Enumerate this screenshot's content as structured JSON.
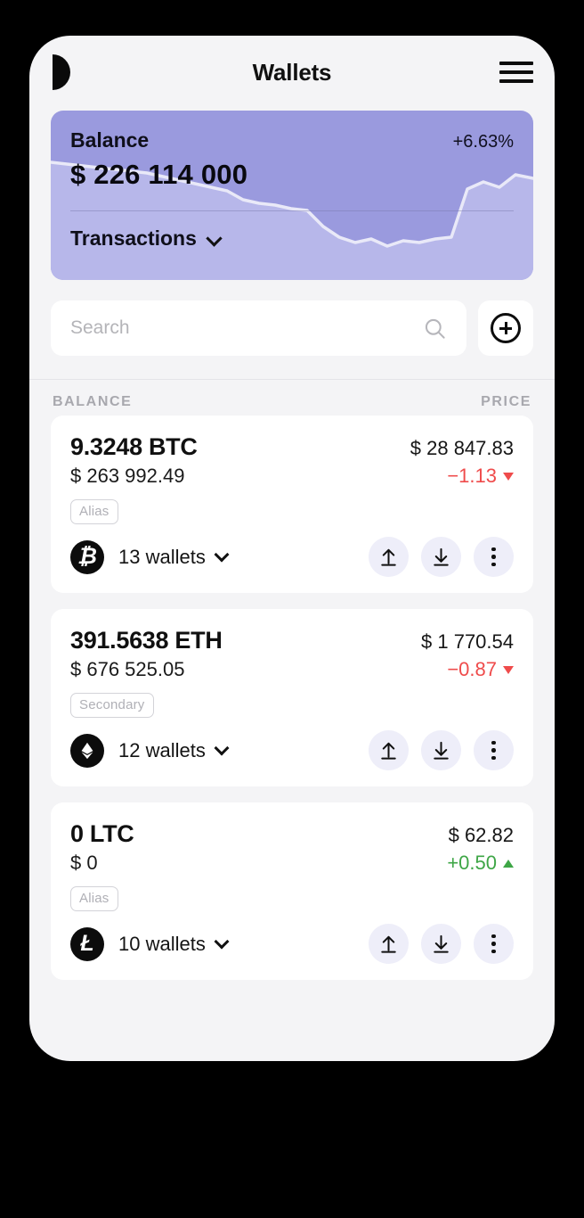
{
  "header": {
    "logo_icon": "brand-d-logo",
    "title": "Wallets",
    "menu_icon": "hamburger-menu-icon"
  },
  "balance_card": {
    "label": "Balance",
    "change": "+6.63%",
    "amount": "$ 226 114 000",
    "transactions_label": "Transactions",
    "chevron_icon": "chevron-down-icon",
    "bg_color": "#9a9ade",
    "area_color": "#b7b7ea",
    "line_color": "#e9e9f8"
  },
  "search": {
    "placeholder": "Search",
    "value": "",
    "icon": "search-icon",
    "add_icon": "plus-circle-icon"
  },
  "list_header": {
    "balance_col": "BALANCE",
    "price_col": "PRICE"
  },
  "assets": [
    {
      "amount": "9.3248 BTC",
      "fiat": "$ 263 992.49",
      "price": "$ 28 847.83",
      "delta": "−1.13",
      "delta_dir": "down",
      "tag": "Alias",
      "coin_icon": "bitcoin-icon",
      "coin_glyph": "₿",
      "wallets": "13 wallets"
    },
    {
      "amount": "391.5638 ETH",
      "fiat": "$ 676 525.05",
      "price": "$ 1 770.54",
      "delta": "−0.87",
      "delta_dir": "down",
      "tag": "Secondary",
      "coin_icon": "ethereum-icon",
      "coin_glyph": "",
      "wallets": "12 wallets"
    },
    {
      "amount": "0 LTC",
      "fiat": "$ 0",
      "price": "$ 62.82",
      "delta": "+0.50",
      "delta_dir": "up",
      "tag": "Alias",
      "coin_icon": "litecoin-icon",
      "coin_glyph": "Ł",
      "wallets": "10 wallets"
    }
  ],
  "actions": {
    "send_icon": "arrow-up-send-icon",
    "receive_icon": "arrow-down-receive-icon",
    "more_icon": "more-vertical-icon"
  },
  "chart_data": {
    "type": "area",
    "title": "Balance sparkline",
    "x": [
      0,
      1,
      2,
      3,
      4,
      5,
      6,
      7,
      8,
      9,
      10,
      11,
      12,
      13,
      14,
      15,
      16,
      17,
      18,
      19,
      20,
      21,
      22,
      23,
      24,
      25,
      26,
      27,
      28,
      29,
      30
    ],
    "values": [
      78,
      77,
      76,
      75,
      74,
      73,
      72,
      70,
      68,
      66,
      64,
      62,
      57,
      55,
      54,
      52,
      51,
      42,
      36,
      33,
      35,
      31,
      34,
      33,
      35,
      36,
      62,
      66,
      63,
      70,
      68
    ],
    "series": [
      {
        "name": "balance",
        "values": [
          78,
          77,
          76,
          75,
          74,
          73,
          72,
          70,
          68,
          66,
          64,
          62,
          57,
          55,
          54,
          52,
          51,
          42,
          36,
          33,
          35,
          31,
          34,
          33,
          35,
          36,
          62,
          66,
          63,
          70,
          68
        ]
      }
    ],
    "ylim": [
      0,
      100
    ],
    "grid": false,
    "legend": "none",
    "xlabel": "",
    "ylabel": ""
  }
}
